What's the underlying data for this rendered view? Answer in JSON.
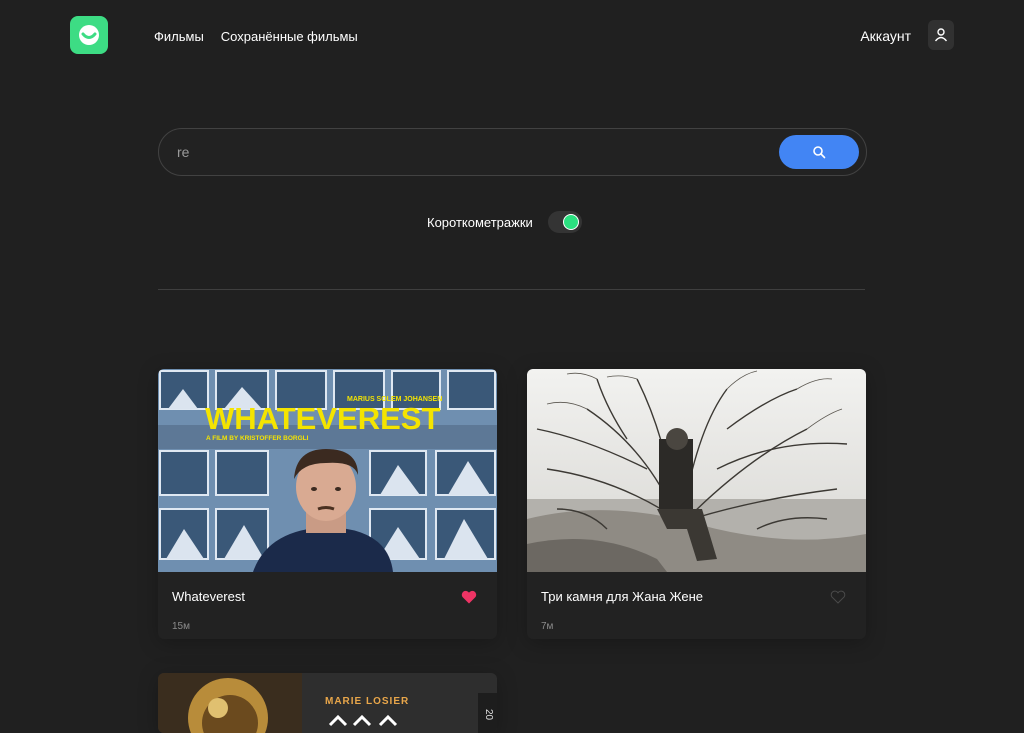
{
  "header": {
    "logo_icon": "smile-logo-icon",
    "nav": [
      "Фильмы",
      "Сохранённые фильмы"
    ],
    "account_label": "Аккаунт",
    "account_icon": "user-icon"
  },
  "search": {
    "value": "re",
    "button_icon": "search-icon",
    "shorts_label": "Короткометражки",
    "shorts_on": true
  },
  "cards": [
    {
      "title": "Whateverest",
      "duration": "15м",
      "liked": true,
      "poster": {
        "credit": "MARIUS SOLEM JOHANSEN",
        "headline": "WHATEVEREST",
        "byline": "A FILM BY KRISTOFFER BORGLI"
      }
    },
    {
      "title": "Три камня для Жана Жене",
      "duration": "7м",
      "liked": false
    },
    {
      "poster": {
        "credit": "MARIE LOSIER",
        "side_text": "20"
      }
    }
  ],
  "colors": {
    "background": "#202020",
    "accent_green": "#3ddc84",
    "accent_blue": "#4285f4",
    "like_active": "#ee3465"
  }
}
